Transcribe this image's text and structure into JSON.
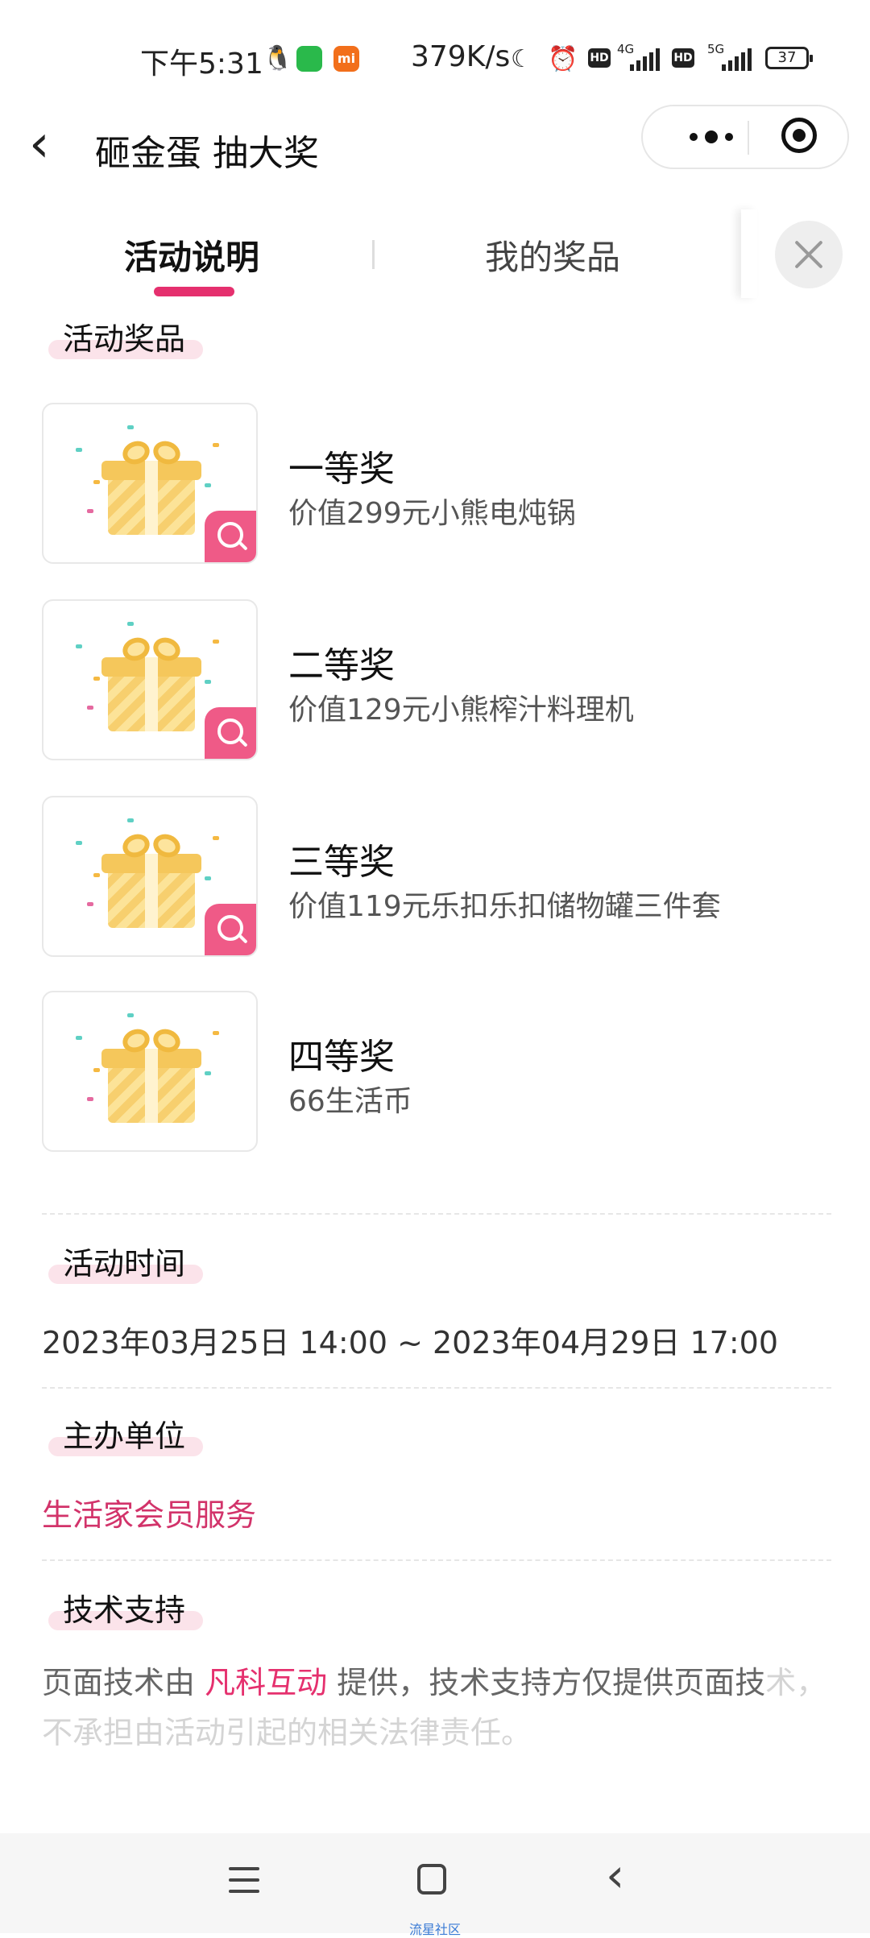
{
  "status_bar": {
    "time": "下午5:31",
    "net_speed": "379K/s",
    "net1": "4G",
    "net2": "5G",
    "hd": "HD",
    "battery": "37",
    "icons": [
      "qq-icon",
      "wechat-icon",
      "mi-icon",
      "moon-icon",
      "alarm-icon",
      "signal-icon",
      "battery-icon"
    ]
  },
  "nav": {
    "back_icon": "chevron-left-icon",
    "title": "砸金蛋 抽大奖",
    "menu_icon": "more-dots-icon",
    "close_icon": "target-circle-icon"
  },
  "tabs": [
    {
      "label": "活动说明",
      "active": true
    },
    {
      "label": "我的奖品",
      "active": false
    }
  ],
  "sections": {
    "prizes_title": "活动奖品",
    "time_title": "活动时间",
    "time_value": "2023年03月25日 14:00 ~ 2023年04月29日 17:00",
    "organizer_title": "主办单位",
    "organizer_value": "生活家会员服务",
    "support_title": "技术支持",
    "support_text": {
      "before": "页面技术由 ",
      "link": "凡科互动",
      "after": " 提供，技术支持方仅提供页面技",
      "faded": "术，不承担由活动引起的相关法律责任。"
    }
  },
  "prizes": [
    {
      "name": "一等奖",
      "desc": "价值299元小熊电炖锅",
      "zoom": true
    },
    {
      "name": "二等奖",
      "desc": "价值129元小熊榨汁料理机",
      "zoom": true
    },
    {
      "name": "三等奖",
      "desc": "价值119元乐扣乐扣储物罐三件套",
      "zoom": true
    },
    {
      "name": "四等奖",
      "desc": "66生活币",
      "zoom": false
    }
  ],
  "watermark": "流星社区",
  "colors": {
    "accent": "#e5306e",
    "highlight": "#fbe3ea",
    "badge": "#ef5a87"
  }
}
